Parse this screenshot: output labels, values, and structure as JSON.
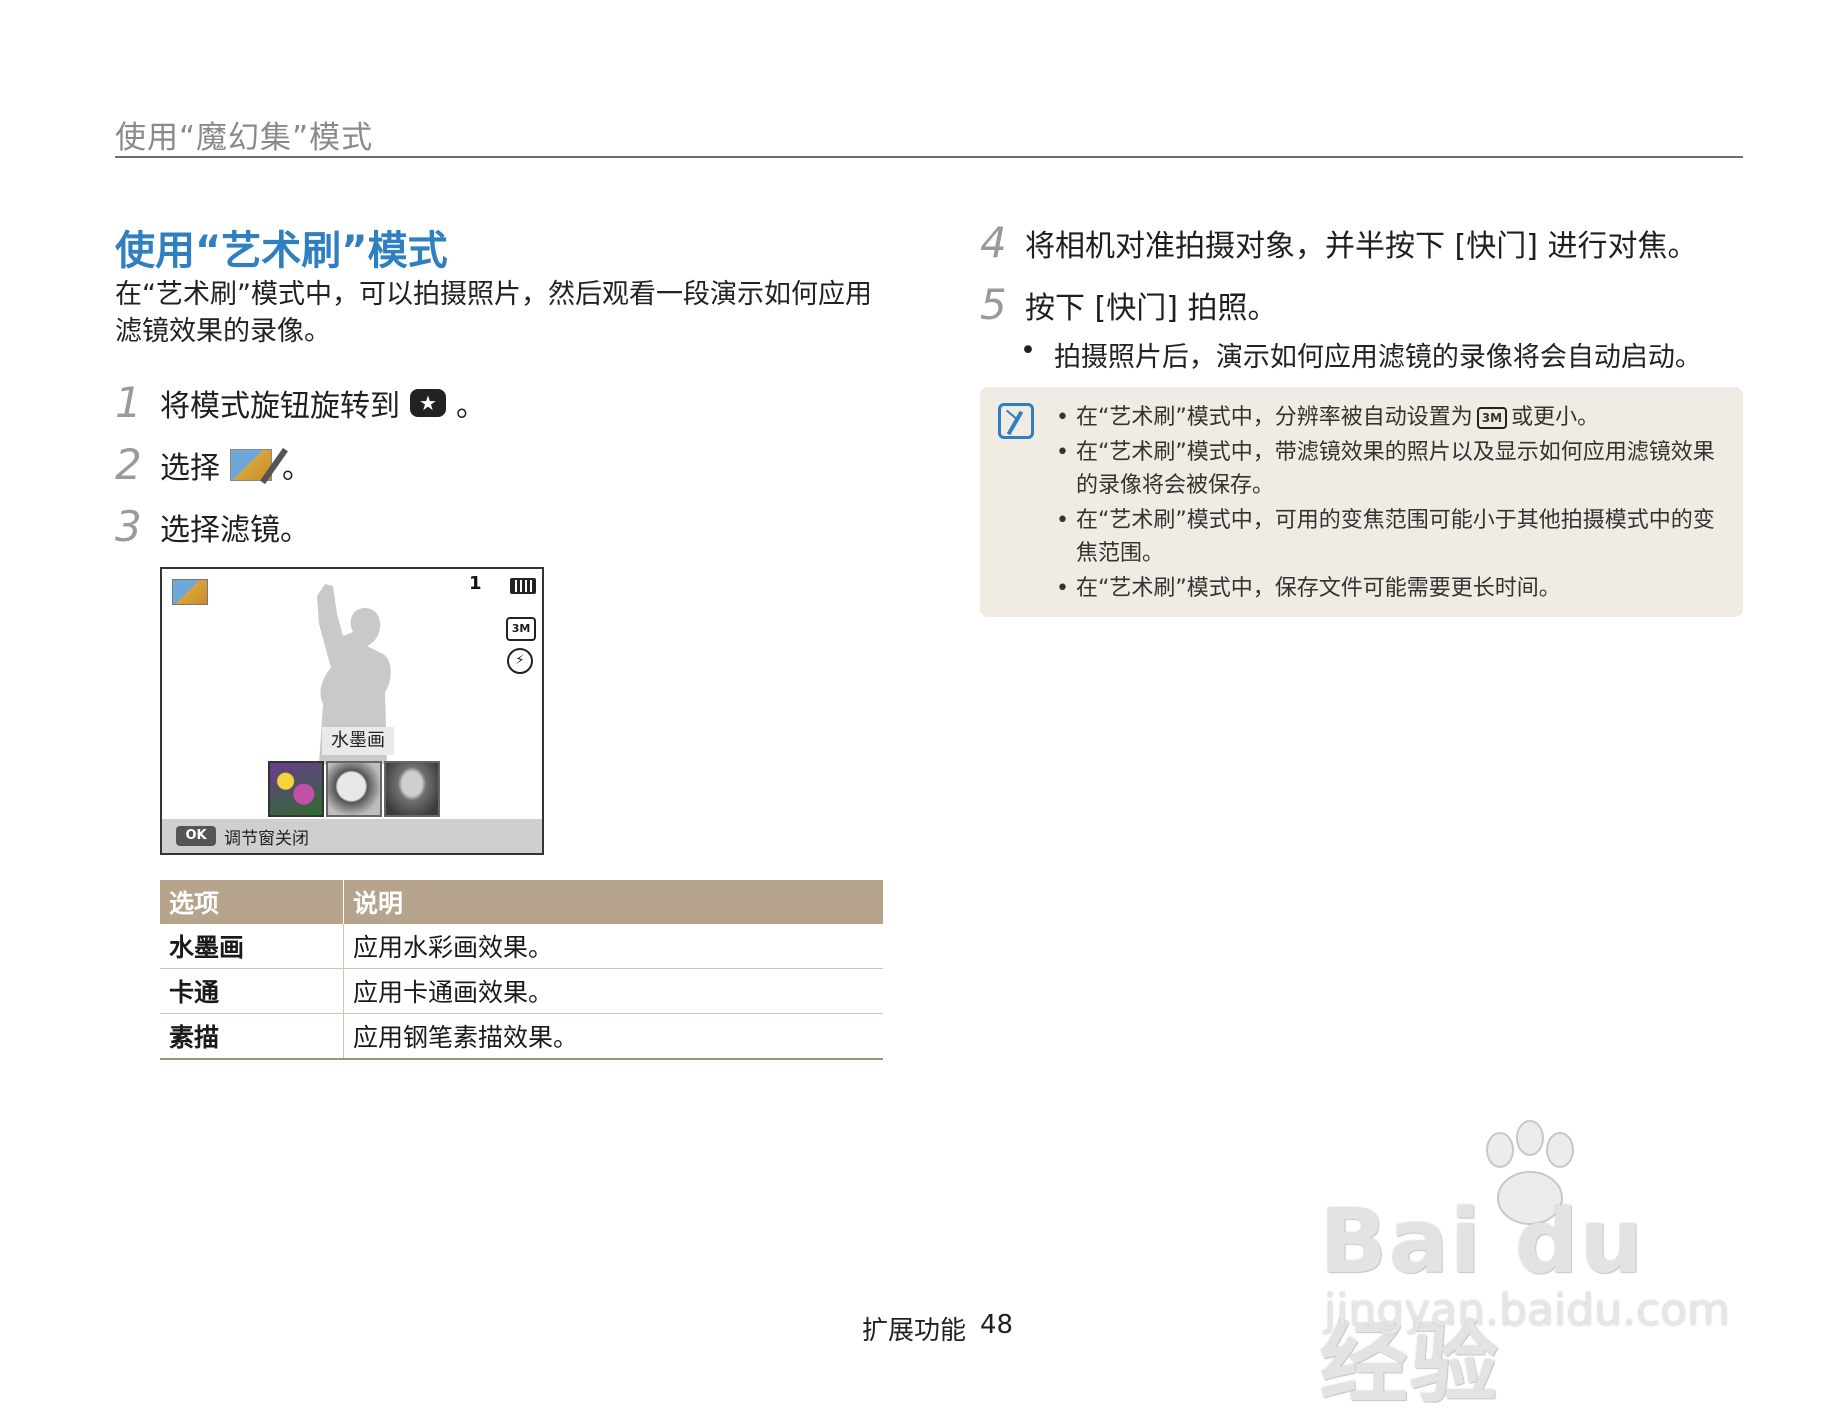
{
  "header": {
    "title": "使用“魔幻集”模式"
  },
  "section": {
    "title": "使用“艺术刷”模式",
    "intro": "在“艺术刷”模式中，可以拍摄照片，然后观看一段演示如何应用滤镜效果的录像。"
  },
  "steps_left": [
    {
      "num": "1",
      "text": "将模式旋钮旋转到",
      "suffix": "。",
      "icon": "magic-mode-icon"
    },
    {
      "num": "2",
      "text": "选择",
      "suffix": "。",
      "icon": "art-brush-icon"
    },
    {
      "num": "3",
      "text": "选择滤镜。"
    }
  ],
  "camera_screen": {
    "shot_count": "1",
    "resolution": "3M",
    "flash_icon": "flash-off-icon",
    "battery_icon": "battery-full-icon",
    "filter_label": "水墨画",
    "ok_key": "OK",
    "bottom_text": "调节窗关闭"
  },
  "table": {
    "headers": [
      "选项",
      "说明"
    ],
    "rows": [
      [
        "水墨画",
        "应用水彩画效果。"
      ],
      [
        "卡通",
        "应用卡通画效果。"
      ],
      [
        "素描",
        "应用钢笔素描效果。"
      ]
    ]
  },
  "steps_right": [
    {
      "num": "4",
      "text": "将相机对准拍摄对象，并半按下 [快门] 进行对焦。"
    },
    {
      "num": "5",
      "text": "按下 [快门] 拍照。"
    }
  ],
  "step5_bullet": "拍摄照片后，演示如何应用滤镜的录像将会自动启动。",
  "notes": {
    "icon": "note-pencil-icon",
    "items": [
      {
        "before": "在“艺术刷”模式中，分辨率被自动设置为",
        "badge": "3M",
        "after": "或更小。"
      },
      {
        "text": "在“艺术刷”模式中，带滤镜效果的照片以及显示如何应用滤镜效果的录像将会被保存。"
      },
      {
        "text": "在“艺术刷”模式中，可用的变焦范围可能小于其他拍摄模式中的变焦范围。"
      },
      {
        "text": "在“艺术刷”模式中，保存文件可能需要更长时间。"
      }
    ]
  },
  "footer": {
    "section": "扩展功能",
    "page": "48"
  },
  "watermark": {
    "main": "Bai du 经验",
    "sub": "jingyan.baidu.com"
  }
}
